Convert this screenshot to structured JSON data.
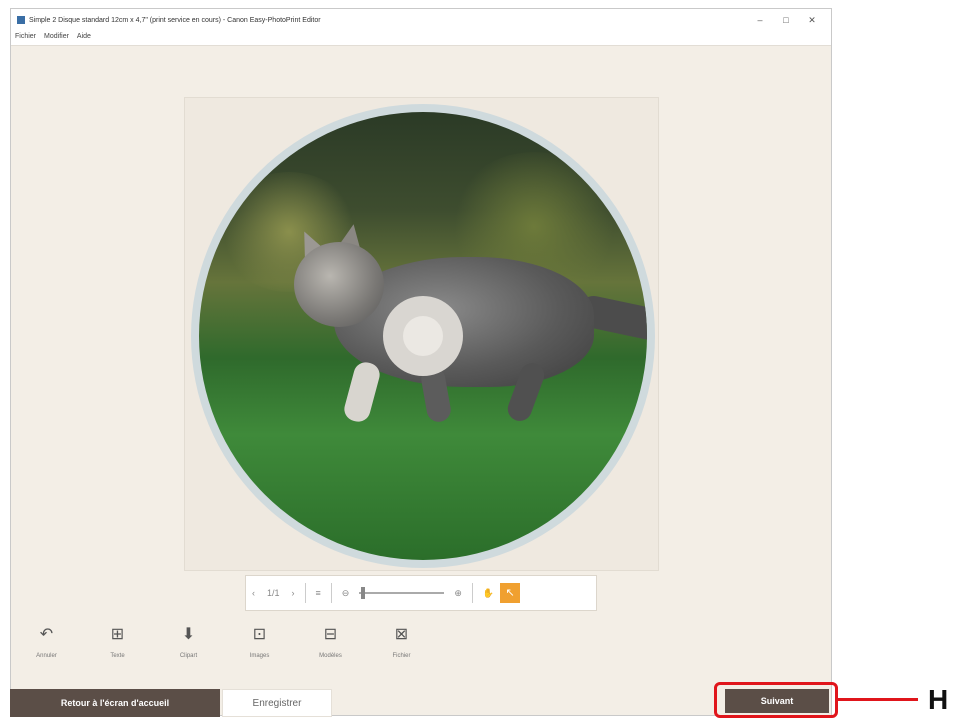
{
  "window": {
    "title": "Simple 2 Disque standard 12cm x 4,7\" (print service en cours) - Canon Easy-PhotoPrint Editor",
    "buttons": [
      "–",
      "□",
      "✕"
    ]
  },
  "menu": [
    "Fichier",
    "Modifier",
    "Aide"
  ],
  "toolbar": {
    "prev": "‹",
    "page": "1/1",
    "next": "›",
    "list_icon": "≡",
    "zoom_out": "⊖",
    "zoom_in": "⊕",
    "hand": "✋",
    "select": "↖"
  },
  "edit_items": [
    {
      "icon": "↶",
      "label": "Annuler"
    },
    {
      "icon": "⊞",
      "label": "Texte"
    },
    {
      "icon": "⬇",
      "label": "Clipart"
    },
    {
      "icon": "⊡",
      "label": "Images"
    },
    {
      "icon": "⊟",
      "label": "Modèles"
    },
    {
      "icon": "⊠",
      "label": "Fichier"
    }
  ],
  "buttons": {
    "back": "Retour à l'écran d'accueil",
    "save": "Enregistrer",
    "next": "Suivant"
  },
  "annotation": {
    "letter": "H",
    "color": "#e0151b"
  }
}
